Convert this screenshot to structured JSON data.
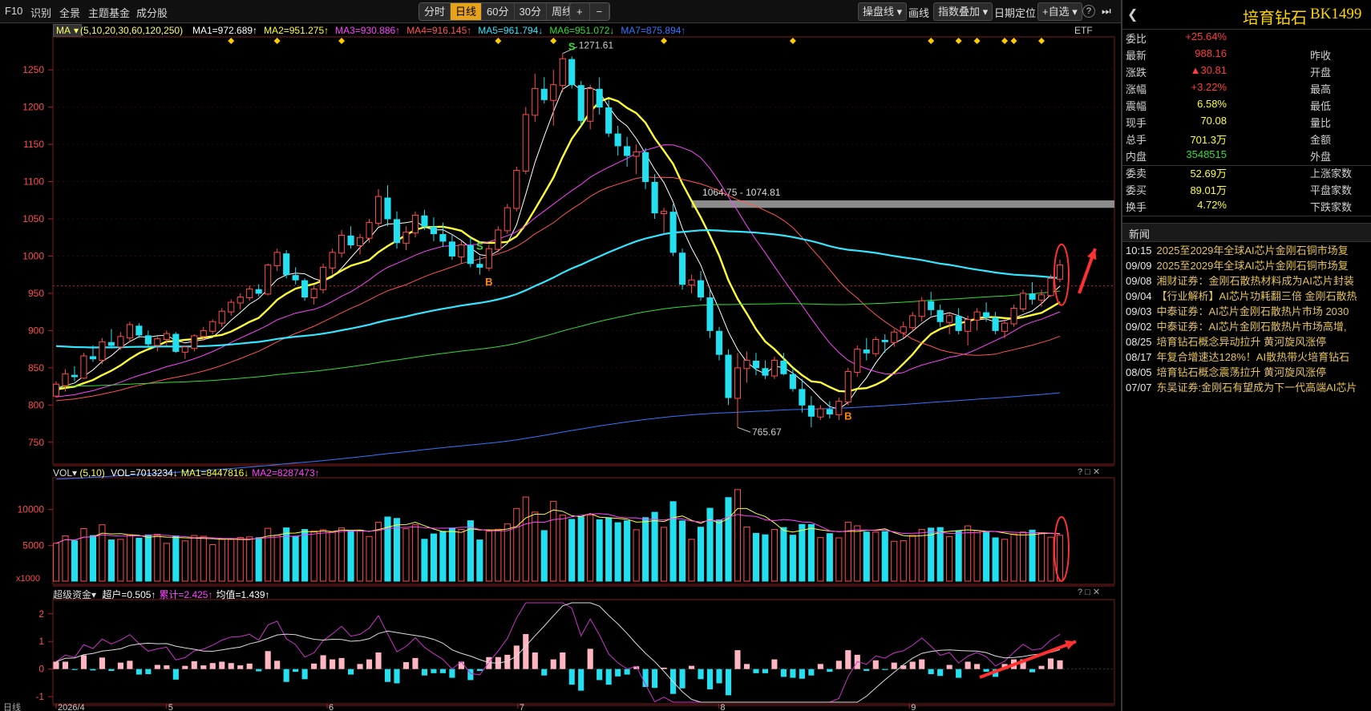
{
  "toolbar": {
    "left_items": [
      "F10",
      "识别",
      "全景",
      "主题基金",
      "成分股"
    ],
    "periods": [
      "分时",
      "日线",
      "60分",
      "30分",
      "周线"
    ],
    "active_period": "日线",
    "zoom_in": "+",
    "zoom_out": "−",
    "pan_line": "操盘线",
    "draw": "画线",
    "index_overlay": "指数叠加",
    "date_locate": "日期定位",
    "add_watch": "+自选",
    "help": "?",
    "next": "⏭"
  },
  "ma_legend": {
    "label": "MA",
    "params": "(5,10,20,30,60,120,250)",
    "items": [
      {
        "text": "MA1=972.689↑",
        "color": "#ffffff"
      },
      {
        "text": "MA2=951.275↑",
        "color": "#ffff33"
      },
      {
        "text": "MA3=930.886↑",
        "color": "#ff44ff"
      },
      {
        "text": "MA4=916.145↑",
        "color": "#ff5555"
      },
      {
        "text": "MA5=961.794↓",
        "color": "#33e6ff"
      },
      {
        "text": "MA6=951.072↓",
        "color": "#33dd33"
      },
      {
        "text": "MA7=875.894↑",
        "color": "#3377ff"
      }
    ],
    "etf": "ETF"
  },
  "price_axis": [
    "1250",
    "1200",
    "1150",
    "1100",
    "1050",
    "1000",
    "950",
    "900",
    "850",
    "800",
    "750"
  ],
  "annotations": {
    "high_label": "1271.61",
    "low_label": "765.67",
    "range_label": "1064.75 - 1074.81",
    "buy": "B",
    "sell": "S"
  },
  "vol_panel": {
    "label": "VOL",
    "params": "(5,10)",
    "items": [
      {
        "text": "VOL=7013234↓",
        "color": "#ffffff"
      },
      {
        "text": "MA1=8447816↓",
        "color": "#ffff33"
      },
      {
        "text": "MA2=8287473↑",
        "color": "#ff44ff"
      }
    ],
    "axis": [
      "10000",
      "5000"
    ],
    "unit": "x1000"
  },
  "fund_panel": {
    "label": "超级资金",
    "items": [
      {
        "text": "超户=0.505↑",
        "color": "#ffffff"
      },
      {
        "text": "累计=2.425↑",
        "color": "#ff44ff"
      },
      {
        "text": "均值=1.439↑",
        "color": "#ffffff"
      }
    ],
    "axis": [
      "2",
      "1",
      "0",
      "-1"
    ],
    "x_labels": [
      "2026/4",
      "5",
      "6",
      "7",
      "8",
      "9"
    ],
    "date_label": "日线"
  },
  "stock": {
    "name": "培育钻石",
    "code": "BK1499"
  },
  "quote": {
    "rows": [
      {
        "k": "委比",
        "v": "+25.64%",
        "vc": "#ff3b3b",
        "k2": ""
      },
      {
        "k": "最新",
        "v": "988.16",
        "vc": "#ff3b3b",
        "k2": "昨收"
      },
      {
        "k": "涨跌",
        "v": "▲30.81",
        "vc": "#ff3b3b",
        "k2": "开盘"
      },
      {
        "k": "涨幅",
        "v": "+3.22%",
        "vc": "#ff3b3b",
        "k2": "最高"
      },
      {
        "k": "震幅",
        "v": "6.58%",
        "vc": "#ffff33",
        "k2": "最低"
      },
      {
        "k": "现手",
        "v": "70.08",
        "vc": "#ffff33",
        "k2": "量比"
      },
      {
        "k": "总手",
        "v": "701.3万",
        "vc": "#ffff33",
        "k2": "金额"
      },
      {
        "k": "内盘",
        "v": "3548515",
        "vc": "#33dd33",
        "k2": "外盘"
      },
      {
        "k": "委卖",
        "v": "52.69万",
        "vc": "#ffff33",
        "k2": "上涨家数"
      },
      {
        "k": "委买",
        "v": "89.01万",
        "vc": "#ffff33",
        "k2": "平盘家数"
      },
      {
        "k": "换手",
        "v": "4.72%",
        "vc": "#ffff33",
        "k2": "下跌家数"
      }
    ]
  },
  "news": {
    "title": "新闻",
    "items": [
      {
        "time": "10:15",
        "text": "2025至2029年全球AI芯片金刚石铜市场复"
      },
      {
        "time": "09/09",
        "text": "2025至2029年全球AI芯片金刚石铜市场复"
      },
      {
        "time": "09/08",
        "text": "湘财证券：金刚石散热材料成为AI芯片封装"
      },
      {
        "time": "09/04",
        "text": "【行业解析】AI芯片功耗翻三倍 金刚石散热"
      },
      {
        "time": "09/03",
        "text": "中泰证券：AI芯片金刚石散热片市场 2030"
      },
      {
        "time": "09/02",
        "text": "中泰证券：AI芯片金刚石散热片市场高增,"
      },
      {
        "time": "08/25",
        "text": "培育钻石概念异动拉升 黄河旋风涨停"
      },
      {
        "time": "08/17",
        "text": "年复合增速达128%！AI散热带火培育钻石"
      },
      {
        "time": "08/05",
        "text": "培育钻石概念震荡拉升 黄河旋风涨停"
      },
      {
        "time": "07/07",
        "text": "东吴证券:金刚石有望成为下一代高端AI芯片"
      }
    ]
  },
  "colors": {
    "up": "#ff4d4d",
    "down": "#22e0f0",
    "ma5": "#ffffff",
    "ma10": "#ffff33",
    "ma20": "#ff44ff",
    "ma30": "#ff5555",
    "ma60": "#33e6ff",
    "ma120": "#33dd33",
    "ma250": "#3377ff",
    "accent": "#e6a21a"
  },
  "chart_data": {
    "type": "candlestick",
    "ylim": [
      725,
      1290
    ],
    "volume_ylim": [
      0,
      14000
    ],
    "fund_ylim": [
      -1.2,
      2.4
    ],
    "ohlc": [
      [
        812,
        832,
        810,
        828
      ],
      [
        826,
        848,
        818,
        842
      ],
      [
        840,
        852,
        832,
        838
      ],
      [
        836,
        870,
        835,
        866
      ],
      [
        865,
        880,
        858,
        862
      ],
      [
        860,
        890,
        855,
        885
      ],
      [
        884,
        902,
        876,
        880
      ],
      [
        878,
        898,
        874,
        892
      ],
      [
        890,
        912,
        884,
        908
      ],
      [
        906,
        910,
        890,
        894
      ],
      [
        893,
        900,
        878,
        882
      ],
      [
        880,
        892,
        872,
        889
      ],
      [
        888,
        900,
        880,
        896
      ],
      [
        895,
        898,
        870,
        872
      ],
      [
        871,
        880,
        862,
        878
      ],
      [
        876,
        895,
        872,
        893
      ],
      [
        892,
        905,
        886,
        900
      ],
      [
        899,
        915,
        895,
        912
      ],
      [
        910,
        930,
        905,
        926
      ],
      [
        925,
        942,
        920,
        938
      ],
      [
        937,
        950,
        928,
        945
      ],
      [
        944,
        960,
        940,
        956
      ],
      [
        955,
        962,
        946,
        950
      ],
      [
        949,
        990,
        947,
        988
      ],
      [
        987,
        1010,
        980,
        1005
      ],
      [
        1003,
        1008,
        970,
        975
      ],
      [
        974,
        985,
        962,
        968
      ],
      [
        967,
        970,
        940,
        945
      ],
      [
        944,
        960,
        935,
        956
      ],
      [
        955,
        990,
        950,
        985
      ],
      [
        984,
        1010,
        976,
        1005
      ],
      [
        1004,
        1035,
        998,
        1028
      ],
      [
        1027,
        1040,
        1010,
        1015
      ],
      [
        1014,
        1030,
        1002,
        1025
      ],
      [
        1024,
        1050,
        1018,
        1045
      ],
      [
        1044,
        1090,
        1040,
        1080
      ],
      [
        1078,
        1095,
        1040,
        1050
      ],
      [
        1049,
        1060,
        1010,
        1018
      ],
      [
        1017,
        1040,
        1008,
        1032
      ],
      [
        1031,
        1060,
        1025,
        1055
      ],
      [
        1054,
        1062,
        1035,
        1040
      ],
      [
        1039,
        1052,
        1020,
        1030
      ],
      [
        1029,
        1045,
        1012,
        1020
      ],
      [
        1019,
        1030,
        995,
        1000
      ],
      [
        999,
        1020,
        990,
        1015
      ],
      [
        1014,
        1025,
        985,
        990
      ],
      [
        989,
        1000,
        975,
        985
      ],
      [
        984,
        1015,
        980,
        1010
      ],
      [
        1009,
        1040,
        1005,
        1035
      ],
      [
        1034,
        1070,
        1030,
        1065
      ],
      [
        1064,
        1120,
        1060,
        1115
      ],
      [
        1114,
        1200,
        1110,
        1190
      ],
      [
        1189,
        1245,
        1180,
        1225
      ],
      [
        1224,
        1240,
        1205,
        1210
      ],
      [
        1209,
        1250,
        1175,
        1230
      ],
      [
        1229,
        1272,
        1220,
        1265
      ],
      [
        1264,
        1268,
        1225,
        1230
      ],
      [
        1229,
        1235,
        1175,
        1182
      ],
      [
        1181,
        1230,
        1170,
        1225
      ],
      [
        1224,
        1240,
        1190,
        1200
      ],
      [
        1199,
        1210,
        1160,
        1165
      ],
      [
        1164,
        1175,
        1135,
        1148
      ],
      [
        1147,
        1160,
        1120,
        1135
      ],
      [
        1134,
        1150,
        1110,
        1140
      ],
      [
        1139,
        1145,
        1090,
        1100
      ],
      [
        1099,
        1110,
        1050,
        1058
      ],
      [
        1057,
        1065,
        1030,
        1060
      ],
      [
        1059,
        1070,
        1000,
        1005
      ],
      [
        1004,
        1010,
        955,
        962
      ],
      [
        961,
        975,
        950,
        968
      ],
      [
        967,
        980,
        940,
        945
      ],
      [
        944,
        955,
        890,
        900
      ],
      [
        899,
        905,
        860,
        868
      ],
      [
        867,
        875,
        800,
        810
      ],
      [
        809,
        870,
        770,
        850
      ],
      [
        849,
        872,
        830,
        860
      ],
      [
        859,
        870,
        840,
        850
      ],
      [
        849,
        860,
        835,
        840
      ],
      [
        839,
        865,
        835,
        860
      ],
      [
        859,
        870,
        840,
        842
      ],
      [
        841,
        850,
        818,
        822
      ],
      [
        821,
        835,
        790,
        800
      ],
      [
        799,
        812,
        770,
        785
      ],
      [
        784,
        800,
        780,
        795
      ],
      [
        794,
        805,
        782,
        788
      ],
      [
        787,
        810,
        780,
        805
      ],
      [
        804,
        850,
        800,
        845
      ],
      [
        844,
        880,
        838,
        875
      ],
      [
        874,
        890,
        860,
        870
      ],
      [
        869,
        892,
        865,
        888
      ],
      [
        887,
        895,
        870,
        885
      ],
      [
        884,
        902,
        878,
        898
      ],
      [
        897,
        912,
        890,
        905
      ],
      [
        904,
        925,
        898,
        920
      ],
      [
        919,
        945,
        912,
        940
      ],
      [
        939,
        952,
        920,
        928
      ],
      [
        927,
        935,
        905,
        912
      ],
      [
        911,
        925,
        895,
        920
      ],
      [
        919,
        930,
        895,
        900
      ],
      [
        899,
        920,
        880,
        915
      ],
      [
        914,
        930,
        900,
        925
      ],
      [
        924,
        938,
        912,
        918
      ],
      [
        917,
        925,
        895,
        900
      ],
      [
        899,
        915,
        890,
        910
      ],
      [
        909,
        935,
        905,
        930
      ],
      [
        929,
        955,
        925,
        950
      ],
      [
        949,
        965,
        935,
        942
      ],
      [
        941,
        955,
        932,
        948
      ],
      [
        947,
        975,
        945,
        970
      ],
      [
        969,
        995,
        965,
        988
      ]
    ]
  }
}
